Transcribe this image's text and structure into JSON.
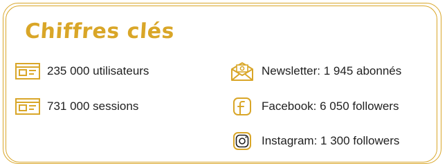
{
  "title": "Chiffres clés",
  "colors": {
    "accent": "#d9a628",
    "text": "#1f1f1f"
  },
  "stats": [
    {
      "label": "235 000 utilisateurs",
      "icon": "browser-window-icon"
    },
    {
      "label": "731 000 sessions",
      "icon": "browser-window-icon"
    },
    {
      "label": "Newsletter: 1 945 abonnés",
      "icon": "envelope-at-icon"
    },
    {
      "label": "Facebook: 6 050 followers",
      "icon": "facebook-icon"
    },
    {
      "label": "Instagram: 1 300 followers",
      "icon": "instagram-icon"
    }
  ]
}
